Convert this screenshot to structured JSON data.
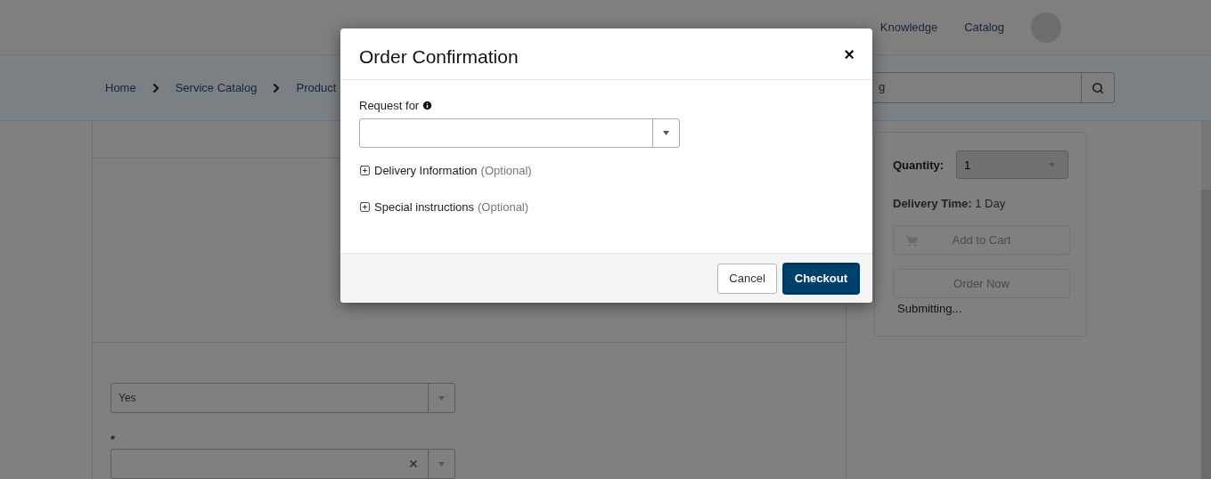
{
  "header": {
    "nav": [
      {
        "label": "Knowledge"
      },
      {
        "label": "Catalog"
      }
    ]
  },
  "breadcrumbs": [
    "Home",
    "Service Catalog",
    "Product"
  ],
  "search": {
    "value": "g"
  },
  "form": {
    "fields": [
      {
        "value": "Yes",
        "clearable": false
      },
      {
        "required_mark": "*",
        "clearable": true
      }
    ]
  },
  "order_panel": {
    "quantity_label": "Quantity:",
    "quantity": "1",
    "delivery_label": "Delivery Time:",
    "delivery_value": "1 Day",
    "buttons": [
      {
        "label": "Add to Cart",
        "kind": "cart",
        "disabled": true
      },
      {
        "label": "Order Now",
        "kind": "plain",
        "disabled": true
      }
    ],
    "status": "Submitting..."
  },
  "modal": {
    "title": "Order Confirmation",
    "close": "×",
    "request_for": {
      "label": "Request for"
    },
    "sections": [
      {
        "label": "Delivery Information",
        "hint": "(Optional)",
        "expanded": false
      },
      {
        "label": "Special instructions",
        "hint": "(Optional)",
        "expanded": false
      }
    ],
    "buttons": [
      {
        "label": "Cancel",
        "kind": "secondary"
      },
      {
        "label": "Checkout",
        "kind": "primary"
      }
    ]
  }
}
